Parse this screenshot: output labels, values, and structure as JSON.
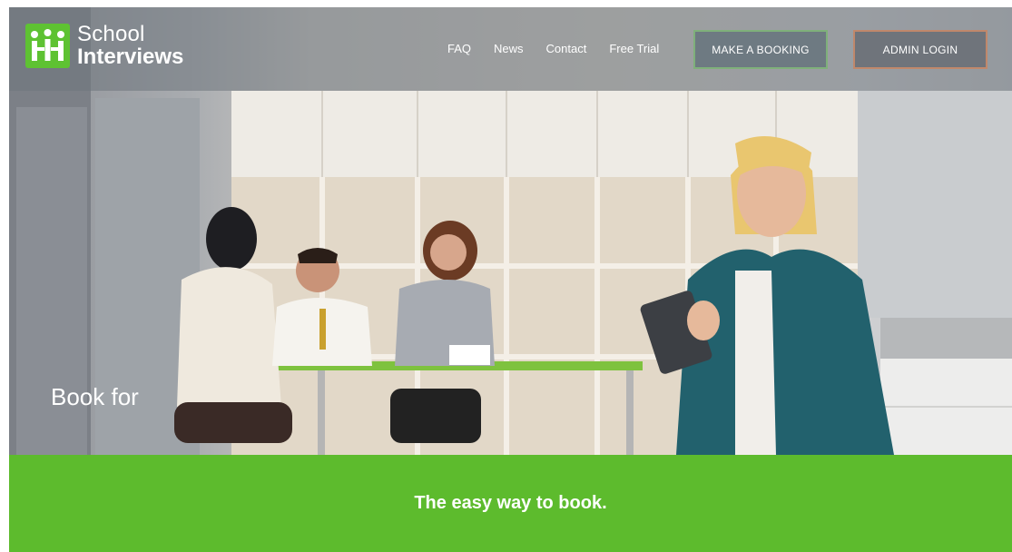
{
  "brand": {
    "name_line1": "School",
    "name_line2": "Interviews",
    "logo_color": "#5ec232"
  },
  "nav": {
    "items": [
      {
        "label": "FAQ"
      },
      {
        "label": "News"
      },
      {
        "label": "Contact"
      },
      {
        "label": "Free Trial"
      }
    ],
    "booking_button": "MAKE A BOOKING",
    "admin_button": "ADMIN LOGIN"
  },
  "hero": {
    "tagline": "Book for"
  },
  "band": {
    "text": "The easy way to book.",
    "color": "#5dbb2d"
  }
}
